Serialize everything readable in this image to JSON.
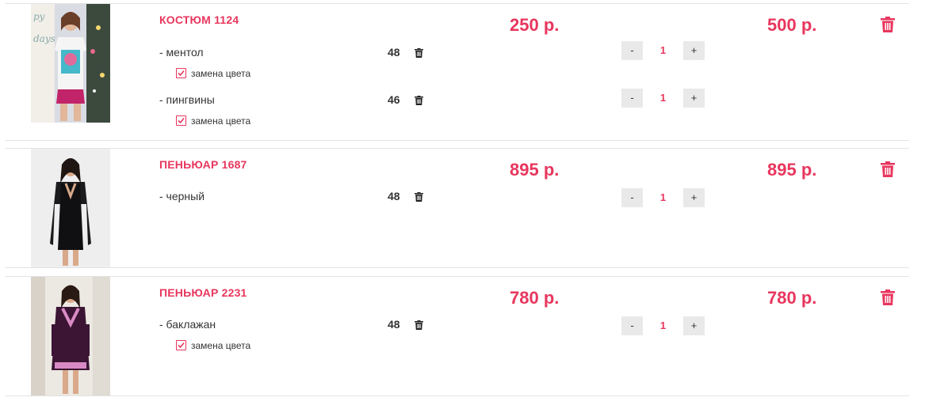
{
  "colors": {
    "accent": "#e8365d",
    "button_bg": "#e9e9e9",
    "divider": "#e3e3e3"
  },
  "items": [
    {
      "title": "КОСТЮМ 1124",
      "price": "250 р.",
      "total": "500 р.",
      "variants": [
        {
          "name": "- ментол",
          "size": "48",
          "qty": "1",
          "minus": "-",
          "plus": "+",
          "swap": "замена цвета",
          "swap_checked": true
        },
        {
          "name": "- пингвины",
          "size": "46",
          "qty": "1",
          "minus": "-",
          "plus": "+",
          "swap": "замена цвета",
          "swap_checked": true
        }
      ]
    },
    {
      "title": "ПЕНЬЮАР 1687",
      "price": "895 р.",
      "total": "895 р.",
      "variants": [
        {
          "name": "- черный",
          "size": "48",
          "qty": "1",
          "minus": "-",
          "plus": "+"
        }
      ]
    },
    {
      "title": "ПЕНЬЮАР 2231",
      "price": "780 р.",
      "total": "780 р.",
      "variants": [
        {
          "name": "- баклажан",
          "size": "48",
          "qty": "1",
          "minus": "-",
          "plus": "+",
          "swap": "замена цвета",
          "swap_checked": true
        }
      ]
    }
  ]
}
